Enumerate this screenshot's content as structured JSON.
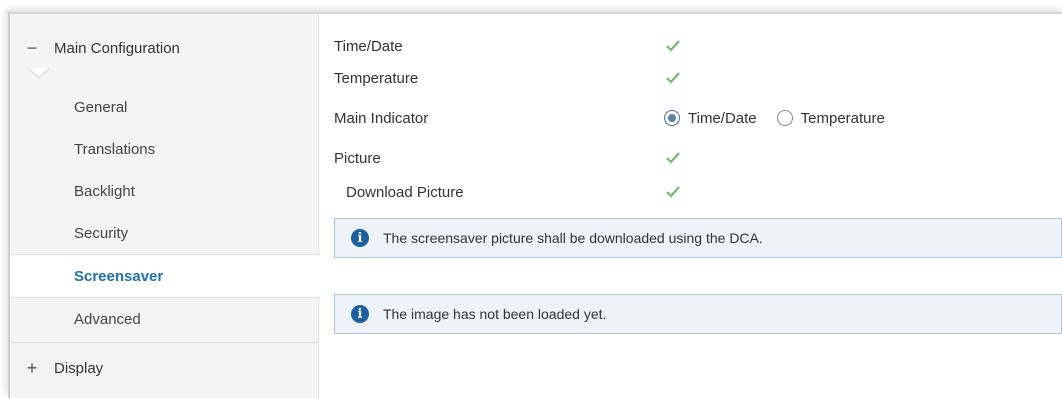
{
  "sidebar": {
    "groups": [
      {
        "sign": "−",
        "label": "Main Configuration"
      },
      {
        "sign": "+",
        "label": "Display"
      }
    ],
    "items": [
      {
        "label": "General"
      },
      {
        "label": "Translations"
      },
      {
        "label": "Backlight"
      },
      {
        "label": "Security"
      },
      {
        "label": "Screensaver",
        "active": true
      },
      {
        "label": "Advanced"
      }
    ]
  },
  "form": {
    "time_date_label": "Time/Date",
    "temperature_label": "Temperature",
    "main_indicator_label": "Main Indicator",
    "main_indicator_options": [
      "Time/Date",
      "Temperature"
    ],
    "main_indicator_selected": "Time/Date",
    "picture_label": "Picture",
    "download_picture_label": "Download Picture",
    "checked": {
      "time_date": true,
      "temperature": true,
      "picture": true,
      "download_picture": true
    }
  },
  "notices": [
    {
      "text": "The screensaver picture shall be downloaded using the DCA."
    },
    {
      "text": "The image has not been loaded yet."
    }
  ],
  "colors": {
    "accent": "#1e70b8",
    "check": "#6abf69",
    "info_bg": "#edf3f8",
    "info_border": "#a9c7df",
    "info_icon": "#1d5fa3"
  },
  "icons": {
    "check": "check-icon",
    "info": "info-icon",
    "collapse": "minus-icon",
    "expand": "plus-icon"
  }
}
